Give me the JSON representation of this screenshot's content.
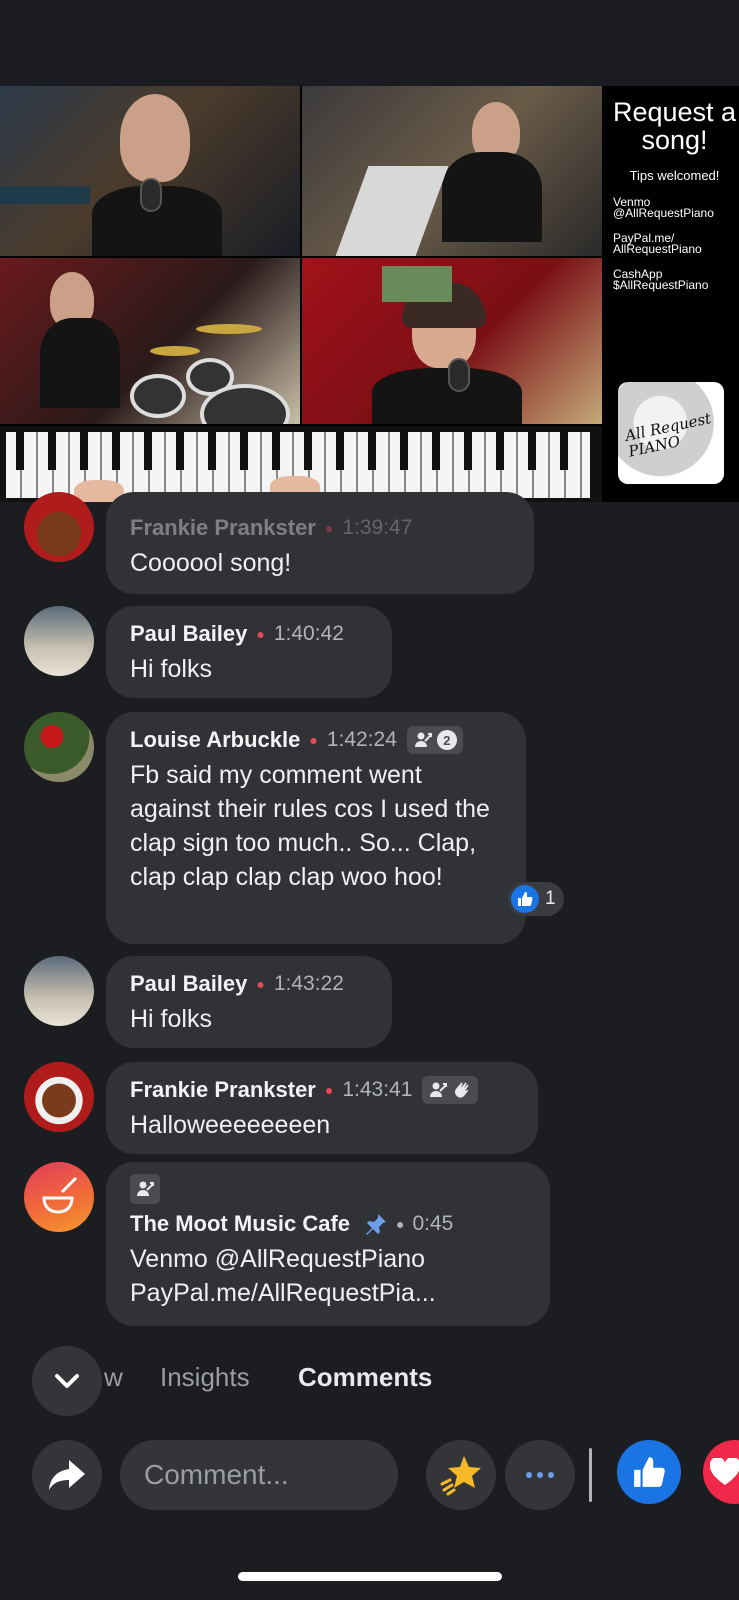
{
  "video": {
    "promo": {
      "title": "Request a song!",
      "tips": "Tips welcomed!",
      "payment_lines": [
        "Venmo @AllRequestPiano",
        "PayPal.me/ AllRequestPiano",
        "CashApp $AllRequestPiano"
      ],
      "logo_text": "All Request PIANO"
    }
  },
  "comments": [
    {
      "name": "Frankie Prankster",
      "time": "1:39:47",
      "text": "Coooool song!"
    },
    {
      "name": "Paul Bailey",
      "time": "1:40:42",
      "text": "Hi folks"
    },
    {
      "name": "Louise Arbuckle",
      "time": "1:42:24",
      "badge_number": "2",
      "text": "Fb said my comment went against their rules cos I used the clap sign too much.. So... Clap, clap clap clap clap woo hoo!",
      "reaction_count": "1"
    },
    {
      "name": "Paul Bailey",
      "time": "1:43:22",
      "text": "Hi folks"
    },
    {
      "name": "Frankie Prankster",
      "time": "1:43:41",
      "text": "Halloweeeeeeeen"
    },
    {
      "name": "The Moot Music Cafe",
      "time": "0:45",
      "lines": [
        "Venmo @AllRequestPiano",
        "PayPal.me/AllRequestPia..."
      ]
    }
  ],
  "tabs": {
    "partial": "w",
    "insights": "Insights",
    "comments": "Comments"
  },
  "bottom": {
    "comment_placeholder": "Comment..."
  },
  "colors": {
    "like_blue": "#1b74e4",
    "love_red": "#f02849",
    "badge_red_dot": "#e44a5a"
  },
  "icons": [
    "chevron-down-icon",
    "share-icon",
    "star-icon",
    "more-icon",
    "like-icon",
    "love-icon",
    "pin-icon",
    "wave-icon",
    "top-fan-icon"
  ]
}
